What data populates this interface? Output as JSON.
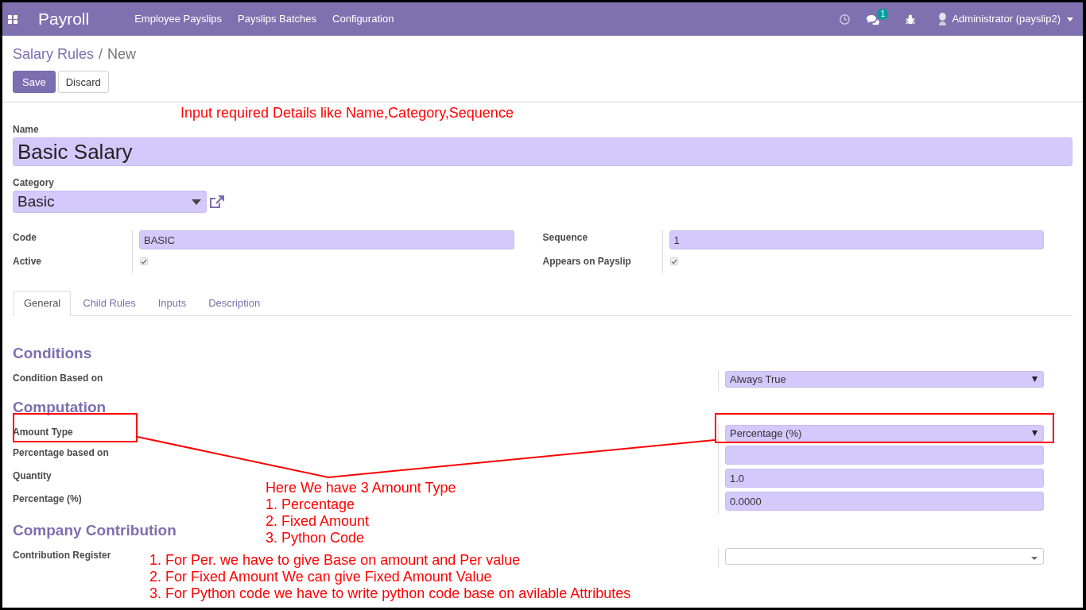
{
  "navbar": {
    "app_name": "Payroll",
    "menu": [
      "Employee Payslips",
      "Payslips Batches",
      "Configuration"
    ],
    "messages_badge": "1",
    "user": "Administrator (payslip2)"
  },
  "breadcrumb": {
    "items": [
      "Salary Rules",
      "New"
    ],
    "separator": "/"
  },
  "buttons": [
    {
      "label": "Save",
      "kind": "primary"
    },
    {
      "label": "Discard",
      "kind": "secondary"
    }
  ],
  "form": {
    "name": {
      "label": "Name",
      "value": "Basic Salary",
      "required": true
    },
    "category": {
      "label": "Category",
      "value": "Basic",
      "required": true
    },
    "groups": [
      {
        "fields": [
          {
            "label": "Code",
            "kind": "text",
            "value": "BASIC",
            "required": true
          },
          {
            "label": "Active",
            "kind": "checkbox",
            "checked": true
          }
        ]
      },
      {
        "fields": [
          {
            "label": "Sequence",
            "kind": "text",
            "value": "1",
            "required": true
          },
          {
            "label": "Appears on Payslip",
            "kind": "checkbox",
            "checked": true
          }
        ]
      }
    ],
    "tabs": [
      {
        "label": "General",
        "selected": true
      },
      {
        "label": "Child Rules",
        "selected": false
      },
      {
        "label": "Inputs",
        "selected": false
      },
      {
        "label": "Description",
        "selected": false
      }
    ],
    "sections": [
      {
        "title": "Conditions",
        "fields": [
          {
            "label": "Condition Based on",
            "kind": "select",
            "value": "Always True",
            "required": true
          }
        ]
      },
      {
        "title": "Computation",
        "fields": [
          {
            "label": "Amount Type",
            "kind": "select",
            "value": "Percentage (%)",
            "required": true
          },
          {
            "label": "Percentage based on",
            "kind": "text",
            "required": true
          },
          {
            "label": "Quantity",
            "kind": "text",
            "value": "1.0",
            "required": true
          },
          {
            "label": "Percentage (%)",
            "kind": "text",
            "value": "0.0000",
            "required": true
          }
        ]
      },
      {
        "title": "Company Contribution",
        "fields": [
          {
            "label": "Contribution Register",
            "kind": "relation",
            "required": false
          }
        ]
      }
    ]
  },
  "annotations": [
    {
      "lines": [
        "Input required Details like Name,Category,Sequence"
      ]
    },
    {
      "lines": [
        "Here We have 3 Amount Type",
        "1. Percentage",
        "2. Fixed Amount",
        "3. Python Code"
      ]
    },
    {
      "lines": [
        "1. For Per. we have to give Base on amount and Per value",
        "2. For Fixed Amount We can give Fixed Amount Value",
        "3. For Python code we have to write python code base on avilable Attributes"
      ]
    }
  ]
}
